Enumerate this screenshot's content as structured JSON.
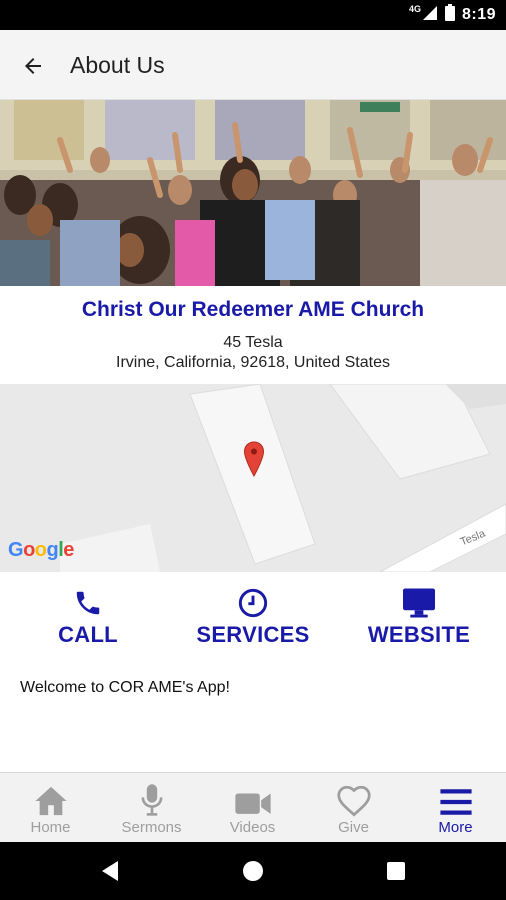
{
  "status_bar": {
    "network_type": "4G",
    "time": "8:19"
  },
  "app_bar": {
    "title": "About Us"
  },
  "church": {
    "name": "Christ Our Redeemer AME Church",
    "address_line1": "45 Tesla",
    "address_line2": "Irvine, California, 92618, United States"
  },
  "map": {
    "logo_text": "Google",
    "street_label": "Tesla"
  },
  "actions": [
    {
      "label": "CALL",
      "icon": "phone-icon"
    },
    {
      "label": "SERVICES",
      "icon": "clock-icon"
    },
    {
      "label": "WEBSITE",
      "icon": "monitor-icon"
    }
  ],
  "welcome_text": "Welcome to COR AME's App!",
  "bottom_nav": {
    "items": [
      {
        "label": "Home",
        "icon": "home-icon"
      },
      {
        "label": "Sermons",
        "icon": "microphone-icon"
      },
      {
        "label": "Videos",
        "icon": "video-camera-icon"
      },
      {
        "label": "Give",
        "icon": "heart-icon"
      },
      {
        "label": "More",
        "icon": "menu-icon"
      }
    ],
    "active_index": 4
  },
  "colors": {
    "accent": "#1a1aa8",
    "inactive": "#9e9e9e"
  }
}
